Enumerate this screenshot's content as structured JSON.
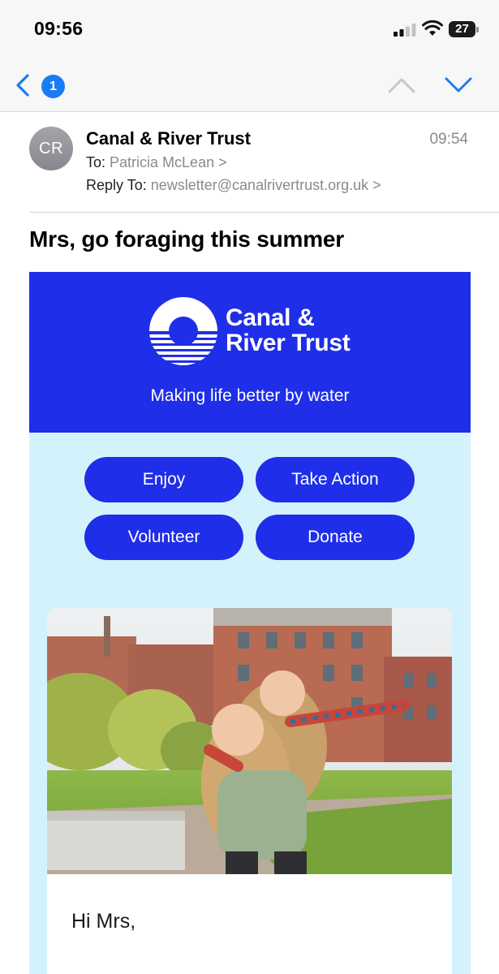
{
  "status_bar": {
    "time": "09:56",
    "battery": "27"
  },
  "nav": {
    "unread_count": "1",
    "icons": [
      "back-chevron-icon",
      "chevron-up-icon",
      "chevron-down-icon"
    ]
  },
  "header": {
    "avatar_initials": "CR",
    "sender": "Canal & River Trust",
    "time": "09:54",
    "to_label": "To:",
    "to_value": "Patricia McLean",
    "reply_label": "Reply To:",
    "reply_value": "newsletter@canalrivertrust.org.uk",
    "chevron": ">"
  },
  "subject": "Mrs, go foraging this summer",
  "hero": {
    "logo_line1": "Canal &",
    "logo_line2": "River Trust",
    "tagline": "Making life better by water"
  },
  "buttons": {
    "enjoy": "Enjoy",
    "take_action": "Take Action",
    "volunteer": "Volunteer",
    "donate": "Donate"
  },
  "card": {
    "greeting": "Hi Mrs,"
  },
  "colors": {
    "brand_blue": "#1f2ee8",
    "body_background": "#d4f2fb",
    "ios_blue": "#1a7cf5"
  }
}
